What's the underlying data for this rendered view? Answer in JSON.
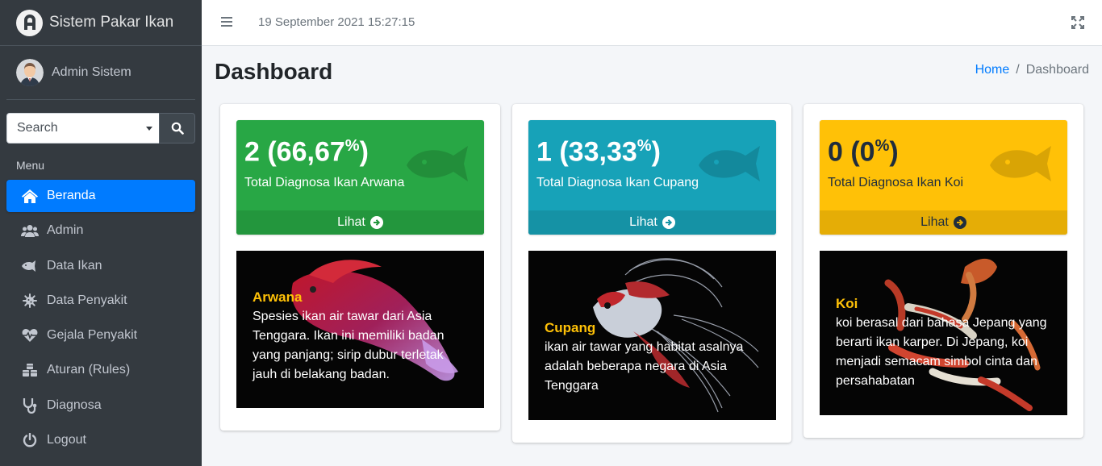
{
  "brand": {
    "name": "Sistem Pakar Ikan"
  },
  "user": {
    "name": "Admin Sistem"
  },
  "search": {
    "placeholder": "Search"
  },
  "menu": {
    "header": "Menu",
    "items": [
      {
        "label": "Beranda",
        "icon": "home-icon",
        "active": true
      },
      {
        "label": "Admin",
        "icon": "users-icon"
      },
      {
        "label": "Data Ikan",
        "icon": "fish-icon"
      },
      {
        "label": "Data Penyakit",
        "icon": "virus-icon"
      },
      {
        "label": "Gejala Penyakit",
        "icon": "heartbeat-icon"
      },
      {
        "label": "Aturan (Rules)",
        "icon": "cubes-icon"
      },
      {
        "label": "Diagnosa",
        "icon": "stethoscope-icon"
      },
      {
        "label": "Logout",
        "icon": "power-icon"
      }
    ]
  },
  "topbar": {
    "datetime": "19 September 2021 15:27:15"
  },
  "page": {
    "title": "Dashboard",
    "breadcrumb": {
      "home": "Home",
      "separator": "/",
      "current": "Dashboard"
    }
  },
  "stats": [
    {
      "count": "2 (66,67",
      "unit": "%",
      "close": ")",
      "label": "Total Diagnosa Ikan Arwana",
      "link": "Lihat",
      "color": "#28a745"
    },
    {
      "count": "1 (33,33",
      "unit": "%",
      "close": ")",
      "label": "Total Diagnosa Ikan Cupang",
      "link": "Lihat",
      "color": "#17a2b8"
    },
    {
      "count": "0 (0",
      "unit": "%",
      "close": ")",
      "label": "Total Diagnosa Ikan Koi",
      "link": "Lihat",
      "color": "#ffc107"
    }
  ],
  "fish": [
    {
      "title": "Arwana",
      "desc": "Spesies ikan air tawar dari Asia Tenggara. Ikan ini memiliki badan yang panjang; sirip dubur terletak jauh di belakang badan."
    },
    {
      "title": "Cupang",
      "desc": "ikan air tawar yang habitat asalnya adalah beberapa negara di Asia Tenggara"
    },
    {
      "title": "Koi",
      "desc": "koi berasal dari bahasa Jepang yang berarti ikan karper. Di Jepang, koi menjadi semacam simbol cinta dan persahabatan"
    }
  ]
}
